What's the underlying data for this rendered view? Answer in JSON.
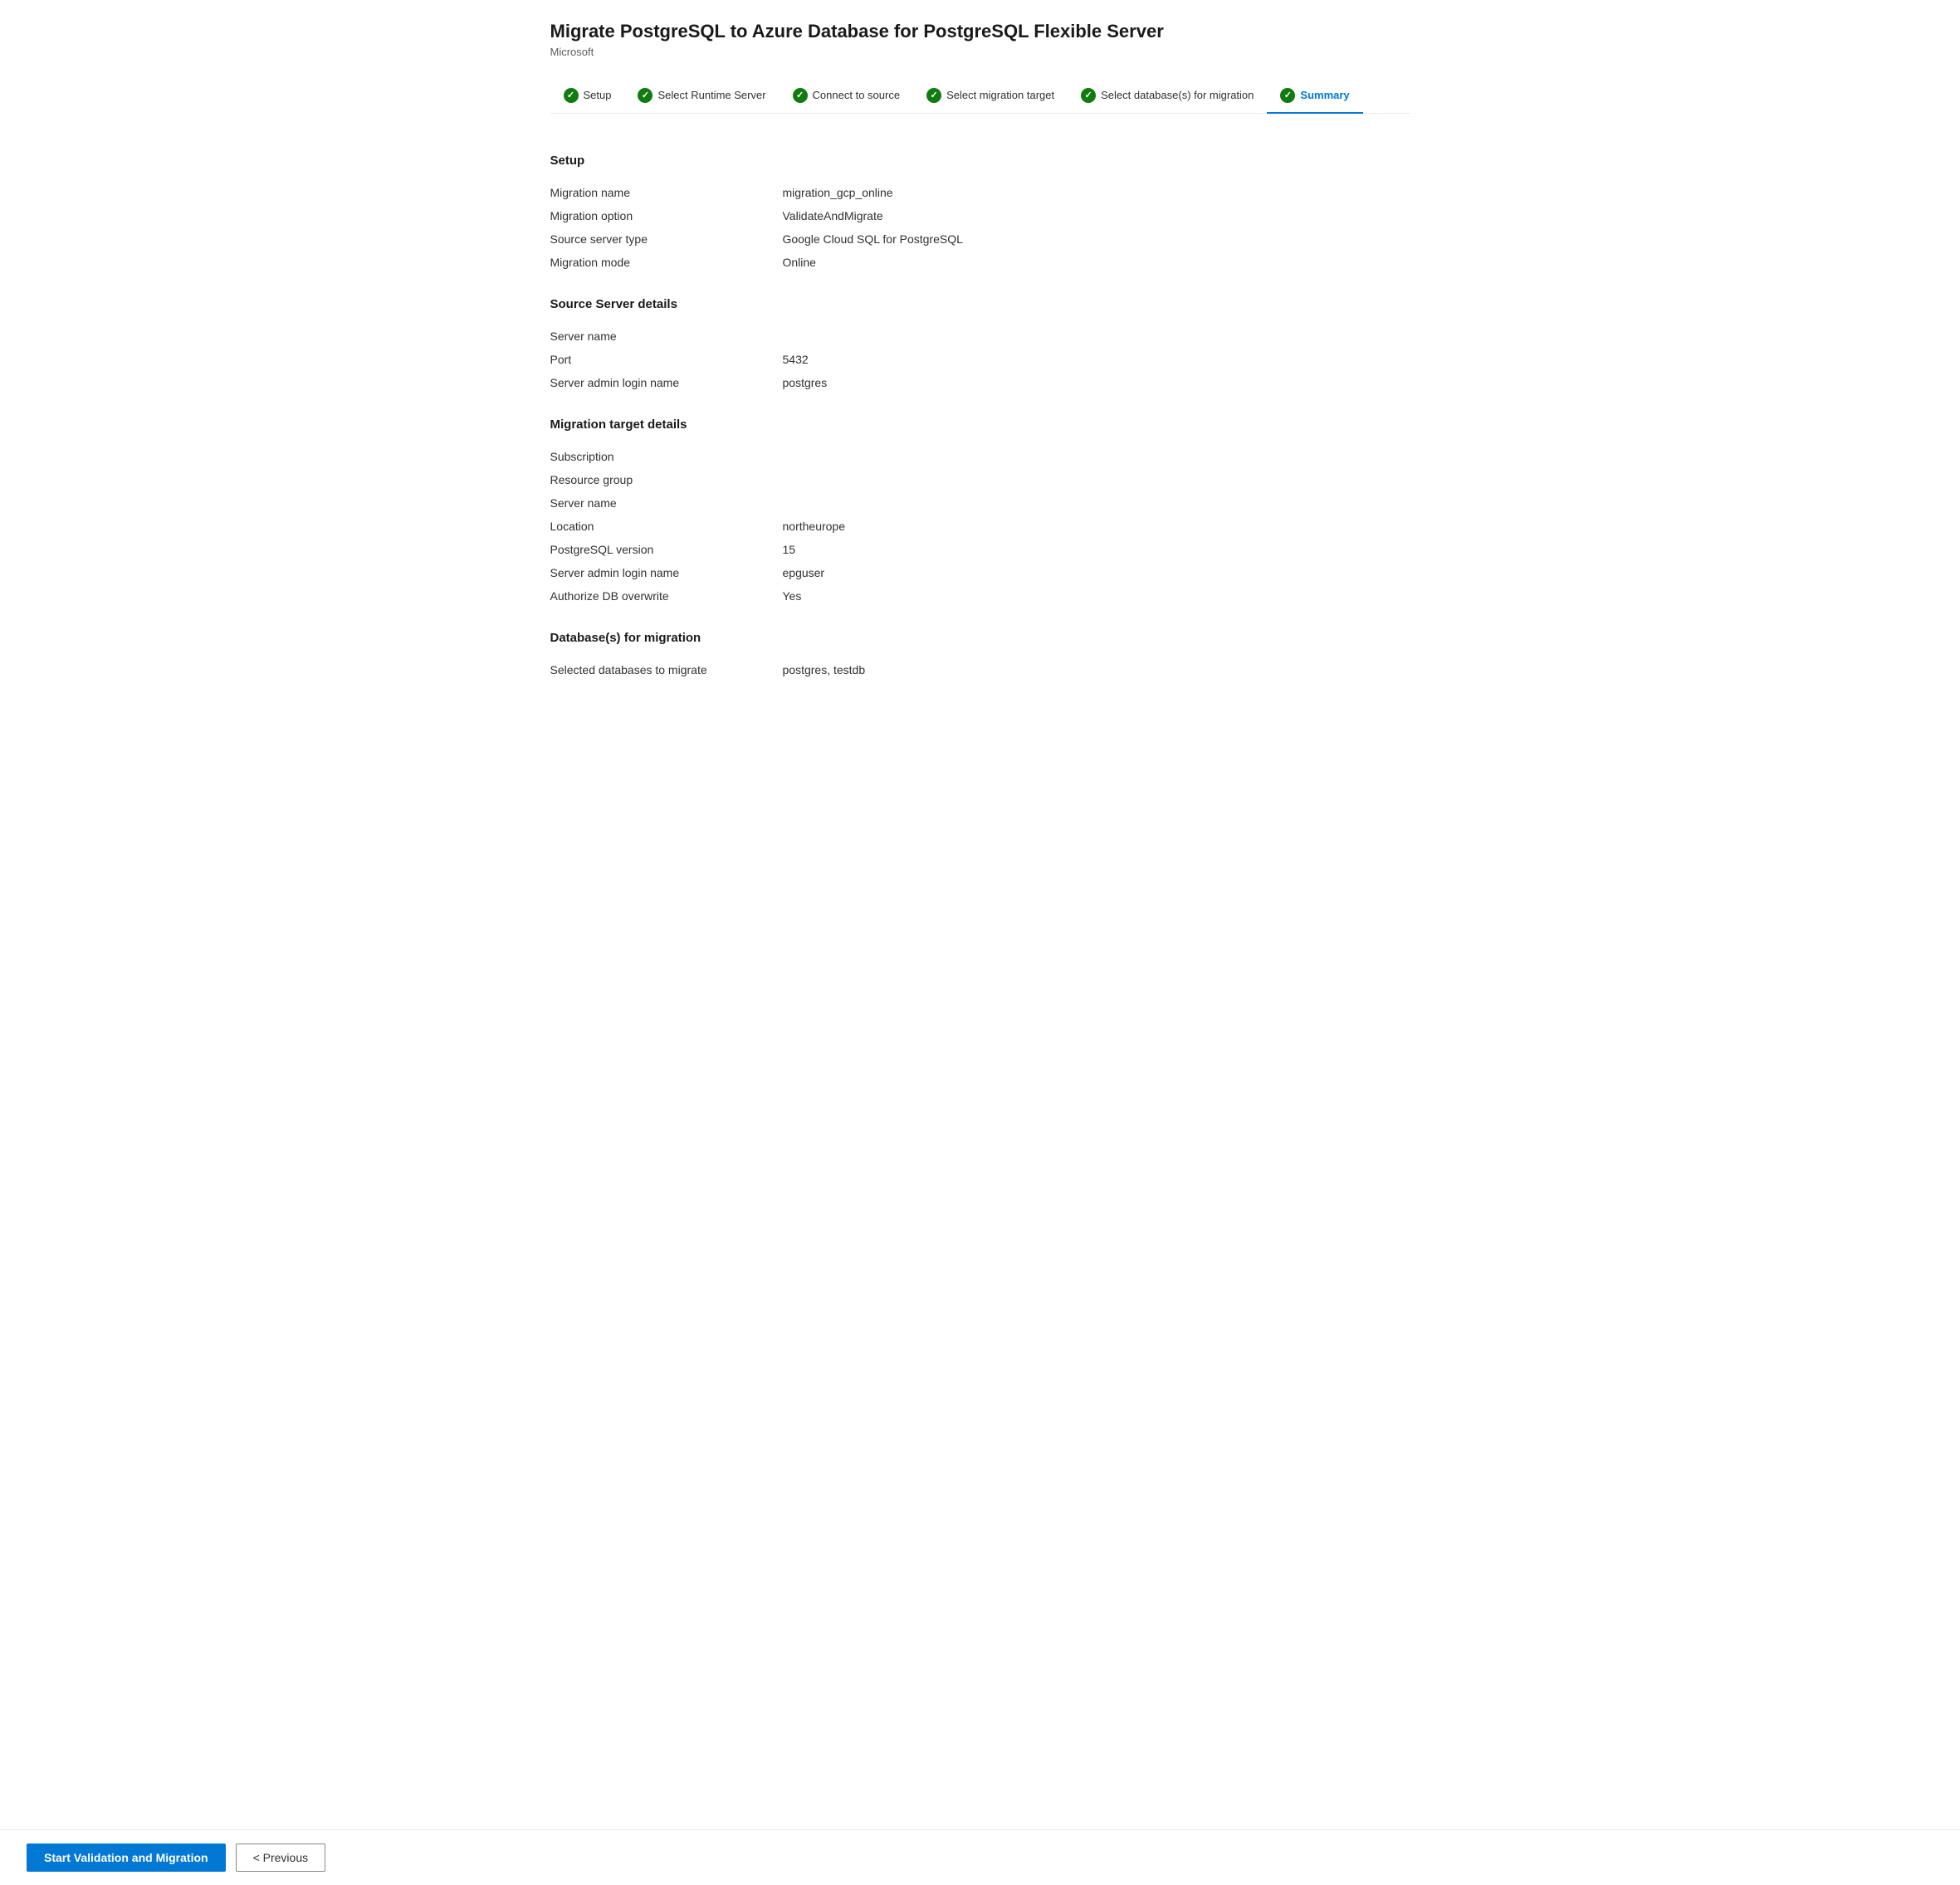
{
  "page": {
    "title": "Migrate PostgreSQL to Azure Database for PostgreSQL Flexible Server",
    "subtitle": "Microsoft",
    "more_label": "···"
  },
  "wizard": {
    "steps": [
      {
        "id": "setup",
        "label": "Setup",
        "active": false,
        "completed": true
      },
      {
        "id": "runtime-server",
        "label": "Select Runtime Server",
        "active": false,
        "completed": true
      },
      {
        "id": "connect-source",
        "label": "Connect to source",
        "active": false,
        "completed": true
      },
      {
        "id": "migration-target",
        "label": "Select migration target",
        "active": false,
        "completed": true
      },
      {
        "id": "select-databases",
        "label": "Select database(s) for migration",
        "active": false,
        "completed": true
      },
      {
        "id": "summary",
        "label": "Summary",
        "active": true,
        "completed": true
      }
    ]
  },
  "sections": {
    "setup": {
      "title": "Setup",
      "fields": [
        {
          "label": "Migration name",
          "value": "migration_gcp_online"
        },
        {
          "label": "Migration option",
          "value": "ValidateAndMigrate"
        },
        {
          "label": "Source server type",
          "value": "Google Cloud SQL for PostgreSQL"
        },
        {
          "label": "Migration mode",
          "value": "Online"
        }
      ]
    },
    "source_server": {
      "title": "Source Server details",
      "fields": [
        {
          "label": "Server name",
          "value": ""
        },
        {
          "label": "Port",
          "value": "5432"
        },
        {
          "label": "Server admin login name",
          "value": "postgres"
        }
      ]
    },
    "migration_target": {
      "title": "Migration target details",
      "fields": [
        {
          "label": "Subscription",
          "value": ""
        },
        {
          "label": "Resource group",
          "value": ""
        },
        {
          "label": "Server name",
          "value": ""
        },
        {
          "label": "Location",
          "value": "northeurope"
        },
        {
          "label": "PostgreSQL version",
          "value": "15"
        },
        {
          "label": "Server admin login name",
          "value": "epguser"
        },
        {
          "label": "Authorize DB overwrite",
          "value": "Yes"
        }
      ]
    },
    "databases": {
      "title": "Database(s) for migration",
      "fields": [
        {
          "label": "Selected databases to migrate",
          "value": "postgres, testdb"
        }
      ]
    }
  },
  "footer": {
    "start_button_label": "Start Validation and Migration",
    "previous_button_label": "< Previous"
  }
}
